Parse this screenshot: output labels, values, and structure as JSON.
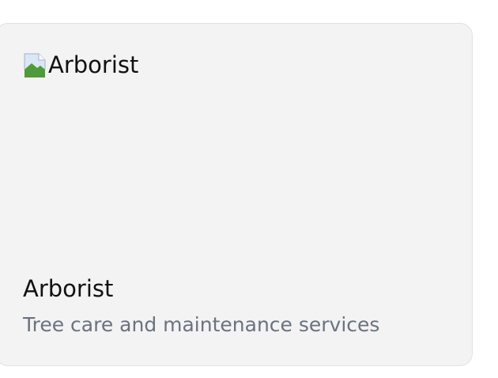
{
  "card": {
    "image_alt": "Arborist",
    "image_icon": "broken-image-icon",
    "title": "Arborist",
    "description": "Tree care and maintenance services"
  },
  "colors": {
    "card_background": "#f3f3f3",
    "card_border": "#e2e2e2",
    "title_text": "#111111",
    "description_text": "#6b7280"
  }
}
